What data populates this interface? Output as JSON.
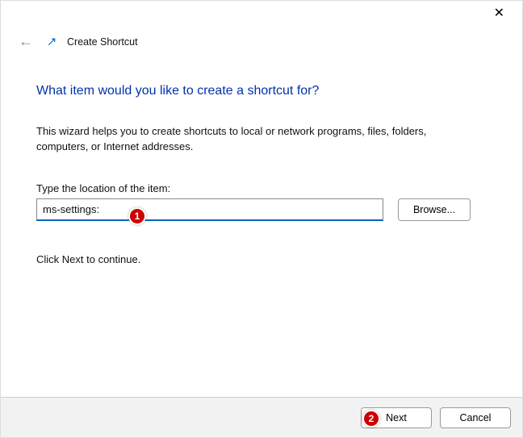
{
  "titlebar": {
    "close_glyph": "✕"
  },
  "header": {
    "back_glyph": "←",
    "window_title": "Create Shortcut"
  },
  "content": {
    "heading": "What item would you like to create a shortcut for?",
    "wizard_text": "This wizard helps you to create shortcuts to local or network programs, files, folders, computers, or Internet addresses.",
    "field_label": "Type the location of the item:",
    "location_value": "ms-settings:",
    "browse_label": "Browse...",
    "continue_text": "Click Next to continue."
  },
  "footer": {
    "next_label": "Next",
    "cancel_label": "Cancel"
  },
  "annotations": {
    "a1": "1",
    "a2": "2"
  }
}
